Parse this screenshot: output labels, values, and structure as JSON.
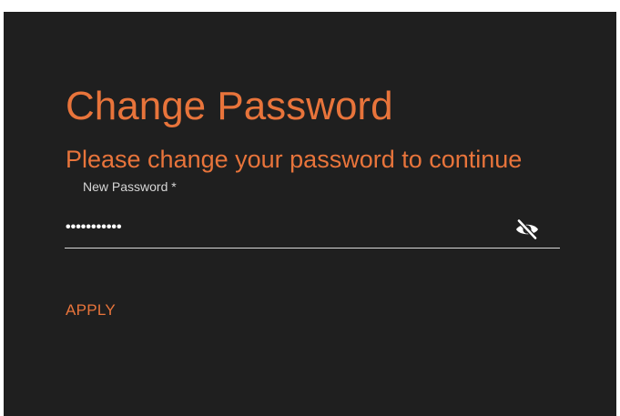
{
  "dialog": {
    "title": "Change Password",
    "subtitle": "Please change your password to continue",
    "accent_color": "#e8743b",
    "background_color": "#1f1f1f"
  },
  "password_field": {
    "label": "New Password *",
    "value": "•••••••••••",
    "toggle_icon": "visibility-off-icon"
  },
  "actions": {
    "apply_label": "APPLY"
  }
}
